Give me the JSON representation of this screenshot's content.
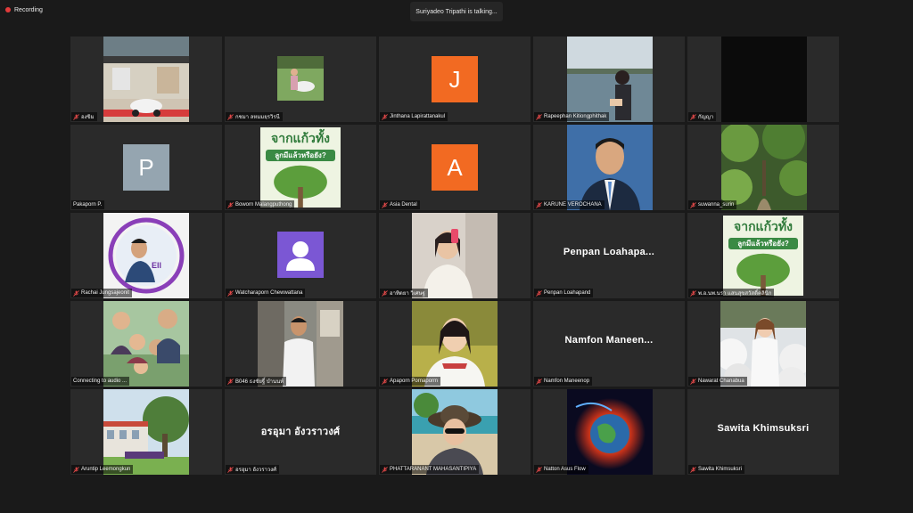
{
  "status": {
    "recording_label": "Recording",
    "talking_label": "Suriyadeo Tripathi is talking..."
  },
  "colors": {
    "background": "#1a1a1a",
    "tile": "#2a2a2a",
    "muted_icon": "#e04848",
    "avatar_orange": "#f26a22",
    "avatar_gray": "#95a5b0",
    "avatar_purple": "#7b57d4"
  },
  "tiles": [
    {
      "name": "องขิม"
    },
    {
      "name": "กชมา ลหมมยฺรวิรนี"
    },
    {
      "name": "Jinthana Lapirattanakul",
      "avatar_letter": "J"
    },
    {
      "name": "Rapeephan Kitiongphithak"
    },
    {
      "name": "กัญญา"
    },
    {
      "name": "Pakaporn P.",
      "avatar_letter": "P"
    },
    {
      "name": "Boworn Malangputhong",
      "poster_line1": "จากแก้วทั้ง",
      "poster_line2": "ลูกมีแล้วหรือยัง?"
    },
    {
      "name": "Asia Dental",
      "avatar_letter": "A"
    },
    {
      "name": "KARUNE VEROCHANA"
    },
    {
      "name": "suwanna_surin"
    },
    {
      "name": "Rachai Jungsajeonit"
    },
    {
      "name": "Watcharaporn Chewwattana"
    },
    {
      "name": "อาทิตยา วิเศษฐ"
    },
    {
      "name": "Penpan Loahapand",
      "display_name": "Penpan  Loahapa..."
    },
    {
      "name": "พ.อ.นพ.นรา แสนสุขสวัสดิ์คลินิก",
      "poster_line1": "จากแก้วทั้ง",
      "poster_line2": "ลูกมีแล้วหรือยัง?"
    },
    {
      "name": "Connecting to audio ..."
    },
    {
      "name": "B046 ธงชัยฐิ์ บำนนท์"
    },
    {
      "name": "Apaporn Pornaporm"
    },
    {
      "name": "Namfon Maneenop",
      "display_name": "Namfon  Maneen..."
    },
    {
      "name": "Nawarat Chanabua"
    },
    {
      "name": "Aruntip Leemongkun"
    },
    {
      "name": "อรอุมา อังวราวงศ์",
      "display_name": "อรอุมา อังวราวงศ์"
    },
    {
      "name": "PHATTARANANT MAHASANTIPIYA"
    },
    {
      "name": "Natton Asus Flow"
    },
    {
      "name": "Sawita Khimsuksri",
      "display_name": "Sawita Khimsuksri"
    }
  ]
}
